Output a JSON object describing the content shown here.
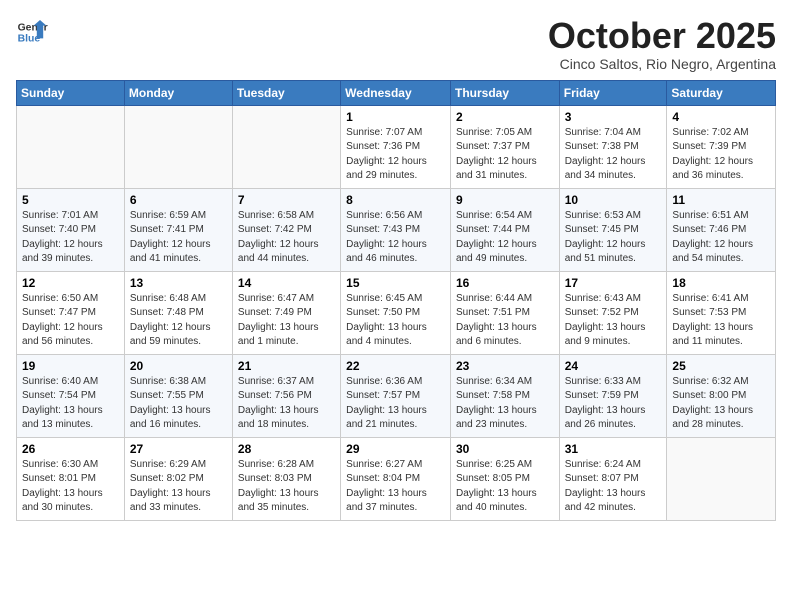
{
  "header": {
    "logo_line1": "General",
    "logo_line2": "Blue",
    "month": "October 2025",
    "location": "Cinco Saltos, Rio Negro, Argentina"
  },
  "days_of_week": [
    "Sunday",
    "Monday",
    "Tuesday",
    "Wednesday",
    "Thursday",
    "Friday",
    "Saturday"
  ],
  "weeks": [
    [
      {
        "day": "",
        "detail": ""
      },
      {
        "day": "",
        "detail": ""
      },
      {
        "day": "",
        "detail": ""
      },
      {
        "day": "1",
        "detail": "Sunrise: 7:07 AM\nSunset: 7:36 PM\nDaylight: 12 hours\nand 29 minutes."
      },
      {
        "day": "2",
        "detail": "Sunrise: 7:05 AM\nSunset: 7:37 PM\nDaylight: 12 hours\nand 31 minutes."
      },
      {
        "day": "3",
        "detail": "Sunrise: 7:04 AM\nSunset: 7:38 PM\nDaylight: 12 hours\nand 34 minutes."
      },
      {
        "day": "4",
        "detail": "Sunrise: 7:02 AM\nSunset: 7:39 PM\nDaylight: 12 hours\nand 36 minutes."
      }
    ],
    [
      {
        "day": "5",
        "detail": "Sunrise: 7:01 AM\nSunset: 7:40 PM\nDaylight: 12 hours\nand 39 minutes."
      },
      {
        "day": "6",
        "detail": "Sunrise: 6:59 AM\nSunset: 7:41 PM\nDaylight: 12 hours\nand 41 minutes."
      },
      {
        "day": "7",
        "detail": "Sunrise: 6:58 AM\nSunset: 7:42 PM\nDaylight: 12 hours\nand 44 minutes."
      },
      {
        "day": "8",
        "detail": "Sunrise: 6:56 AM\nSunset: 7:43 PM\nDaylight: 12 hours\nand 46 minutes."
      },
      {
        "day": "9",
        "detail": "Sunrise: 6:54 AM\nSunset: 7:44 PM\nDaylight: 12 hours\nand 49 minutes."
      },
      {
        "day": "10",
        "detail": "Sunrise: 6:53 AM\nSunset: 7:45 PM\nDaylight: 12 hours\nand 51 minutes."
      },
      {
        "day": "11",
        "detail": "Sunrise: 6:51 AM\nSunset: 7:46 PM\nDaylight: 12 hours\nand 54 minutes."
      }
    ],
    [
      {
        "day": "12",
        "detail": "Sunrise: 6:50 AM\nSunset: 7:47 PM\nDaylight: 12 hours\nand 56 minutes."
      },
      {
        "day": "13",
        "detail": "Sunrise: 6:48 AM\nSunset: 7:48 PM\nDaylight: 12 hours\nand 59 minutes."
      },
      {
        "day": "14",
        "detail": "Sunrise: 6:47 AM\nSunset: 7:49 PM\nDaylight: 13 hours\nand 1 minute."
      },
      {
        "day": "15",
        "detail": "Sunrise: 6:45 AM\nSunset: 7:50 PM\nDaylight: 13 hours\nand 4 minutes."
      },
      {
        "day": "16",
        "detail": "Sunrise: 6:44 AM\nSunset: 7:51 PM\nDaylight: 13 hours\nand 6 minutes."
      },
      {
        "day": "17",
        "detail": "Sunrise: 6:43 AM\nSunset: 7:52 PM\nDaylight: 13 hours\nand 9 minutes."
      },
      {
        "day": "18",
        "detail": "Sunrise: 6:41 AM\nSunset: 7:53 PM\nDaylight: 13 hours\nand 11 minutes."
      }
    ],
    [
      {
        "day": "19",
        "detail": "Sunrise: 6:40 AM\nSunset: 7:54 PM\nDaylight: 13 hours\nand 13 minutes."
      },
      {
        "day": "20",
        "detail": "Sunrise: 6:38 AM\nSunset: 7:55 PM\nDaylight: 13 hours\nand 16 minutes."
      },
      {
        "day": "21",
        "detail": "Sunrise: 6:37 AM\nSunset: 7:56 PM\nDaylight: 13 hours\nand 18 minutes."
      },
      {
        "day": "22",
        "detail": "Sunrise: 6:36 AM\nSunset: 7:57 PM\nDaylight: 13 hours\nand 21 minutes."
      },
      {
        "day": "23",
        "detail": "Sunrise: 6:34 AM\nSunset: 7:58 PM\nDaylight: 13 hours\nand 23 minutes."
      },
      {
        "day": "24",
        "detail": "Sunrise: 6:33 AM\nSunset: 7:59 PM\nDaylight: 13 hours\nand 26 minutes."
      },
      {
        "day": "25",
        "detail": "Sunrise: 6:32 AM\nSunset: 8:00 PM\nDaylight: 13 hours\nand 28 minutes."
      }
    ],
    [
      {
        "day": "26",
        "detail": "Sunrise: 6:30 AM\nSunset: 8:01 PM\nDaylight: 13 hours\nand 30 minutes."
      },
      {
        "day": "27",
        "detail": "Sunrise: 6:29 AM\nSunset: 8:02 PM\nDaylight: 13 hours\nand 33 minutes."
      },
      {
        "day": "28",
        "detail": "Sunrise: 6:28 AM\nSunset: 8:03 PM\nDaylight: 13 hours\nand 35 minutes."
      },
      {
        "day": "29",
        "detail": "Sunrise: 6:27 AM\nSunset: 8:04 PM\nDaylight: 13 hours\nand 37 minutes."
      },
      {
        "day": "30",
        "detail": "Sunrise: 6:25 AM\nSunset: 8:05 PM\nDaylight: 13 hours\nand 40 minutes."
      },
      {
        "day": "31",
        "detail": "Sunrise: 6:24 AM\nSunset: 8:07 PM\nDaylight: 13 hours\nand 42 minutes."
      },
      {
        "day": "",
        "detail": ""
      }
    ]
  ]
}
